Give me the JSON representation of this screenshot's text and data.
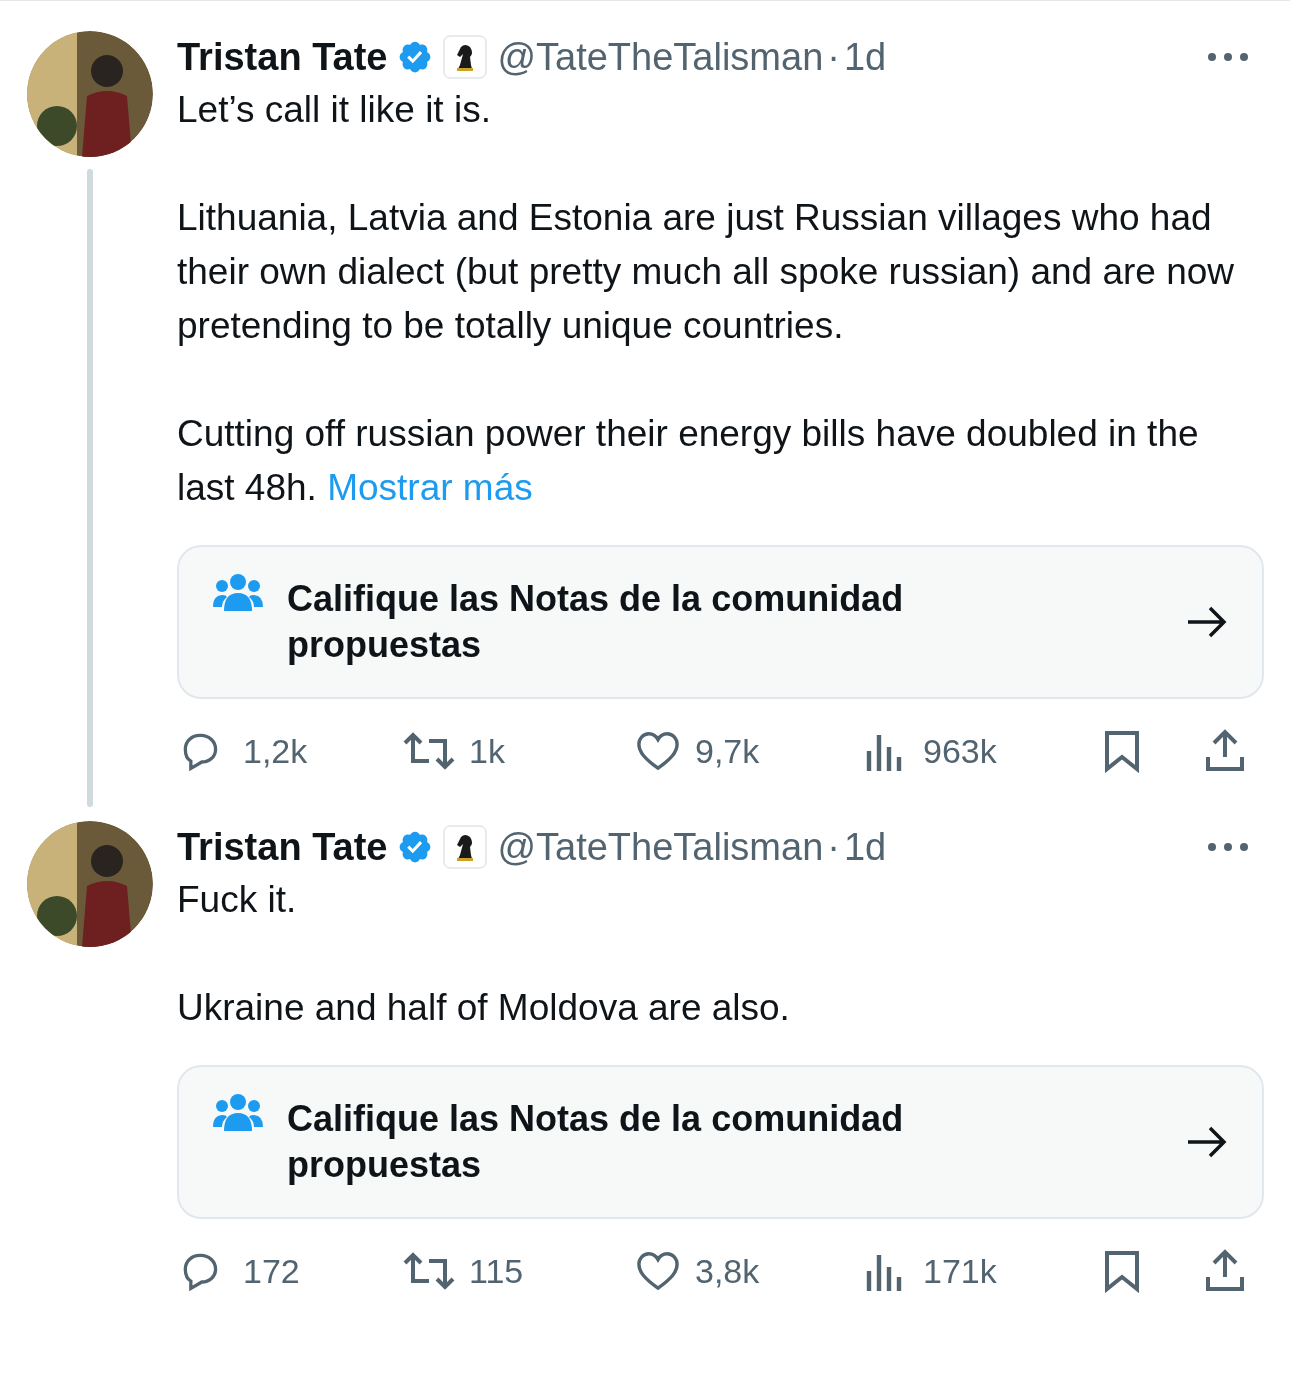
{
  "tweets": [
    {
      "name": "Tristan Tate",
      "handle": "@TateTheTalisman",
      "separator": "·",
      "time": "1d",
      "paragraphs": [
        "Let’s call it like it is.",
        "Lithuania, Latvia and Estonia are just Russian villages who had their own dialect (but pretty much all spoke russian) and are now pretending to be totally unique countries.",
        "Cutting off russian power their energy bills have doubled in the last 48h."
      ],
      "show_more": "Mostrar más",
      "note": "Califique las Notas de la comunidad propuestas",
      "stats": {
        "replies": "1,2k",
        "reposts": "1k",
        "likes": "9,7k",
        "views": "963k"
      }
    },
    {
      "name": "Tristan Tate",
      "handle": "@TateTheTalisman",
      "separator": "·",
      "time": "1d",
      "paragraphs": [
        "Fuck it.",
        "Ukraine and half of Moldova are also."
      ],
      "note": "Califique las Notas de la comunidad propuestas",
      "stats": {
        "replies": "172",
        "reposts": "115",
        "likes": "3,8k",
        "views": "171k"
      }
    }
  ]
}
